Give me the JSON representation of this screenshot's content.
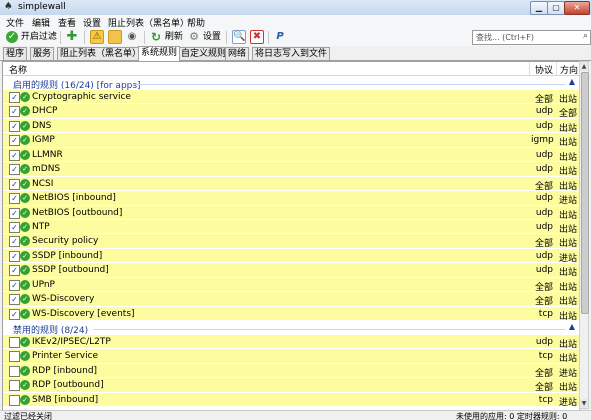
{
  "window": {
    "title": "simplewall"
  },
  "menu": [
    "文件",
    "编辑",
    "查看",
    "设置",
    "阻止列表（黑名单）",
    "帮助"
  ],
  "toolbar": {
    "enable_filter": "开启过滤",
    "refresh": "刷新",
    "settings": "设置"
  },
  "search": {
    "placeholder": "查找... (Ctrl+F)"
  },
  "tabs": [
    "程序",
    "服务",
    "阻止列表（黑名单）",
    "系统规则",
    "自定义规则",
    "网络",
    "将日志写入到文件"
  ],
  "active_tab": "系统规则",
  "columns": {
    "name": "名称",
    "protocol": "协议",
    "direction": "方向"
  },
  "groups": [
    {
      "label": "启用的规则 (16/24) [for apps]",
      "rows": [
        {
          "name": "Cryptographic service",
          "protocol": "全部",
          "direction": "出站",
          "checked": true
        },
        {
          "name": "DHCP",
          "protocol": "udp",
          "direction": "全部",
          "checked": true
        },
        {
          "name": "DNS",
          "protocol": "udp",
          "direction": "出站",
          "checked": true
        },
        {
          "name": "IGMP",
          "protocol": "igmp",
          "direction": "出站",
          "checked": true
        },
        {
          "name": "LLMNR",
          "protocol": "udp",
          "direction": "出站",
          "checked": true
        },
        {
          "name": "mDNS",
          "protocol": "udp",
          "direction": "出站",
          "checked": true
        },
        {
          "name": "NCSI",
          "protocol": "全部",
          "direction": "出站",
          "checked": true
        },
        {
          "name": "NetBIOS [inbound]",
          "protocol": "udp",
          "direction": "进站",
          "checked": true
        },
        {
          "name": "NetBIOS [outbound]",
          "protocol": "udp",
          "direction": "出站",
          "checked": true
        },
        {
          "name": "NTP",
          "protocol": "udp",
          "direction": "出站",
          "checked": true
        },
        {
          "name": "Security policy",
          "protocol": "全部",
          "direction": "出站",
          "checked": true
        },
        {
          "name": "SSDP [inbound]",
          "protocol": "udp",
          "direction": "进站",
          "checked": true
        },
        {
          "name": "SSDP [outbound]",
          "protocol": "udp",
          "direction": "出站",
          "checked": true
        },
        {
          "name": "UPnP",
          "protocol": "全部",
          "direction": "出站",
          "checked": true
        },
        {
          "name": "WS-Discovery",
          "protocol": "全部",
          "direction": "出站",
          "checked": true
        },
        {
          "name": "WS-Discovery [events]",
          "protocol": "tcp",
          "direction": "出站",
          "checked": true
        }
      ]
    },
    {
      "label": "禁用的规则 (8/24)",
      "rows": [
        {
          "name": "IKEv2/IPSEC/L2TP",
          "protocol": "udp",
          "direction": "出站",
          "checked": false
        },
        {
          "name": "Printer Service",
          "protocol": "tcp",
          "direction": "出站",
          "checked": false
        },
        {
          "name": "RDP [inbound]",
          "protocol": "全部",
          "direction": "进站",
          "checked": false
        },
        {
          "name": "RDP [outbound]",
          "protocol": "全部",
          "direction": "出站",
          "checked": false
        },
        {
          "name": "SMB [inbound]",
          "protocol": "tcp",
          "direction": "进站",
          "checked": false
        }
      ]
    }
  ],
  "status": {
    "left": "过滤已经关闭",
    "right": "未使用的应用: 0    定时器规则: 0"
  },
  "colors": {
    "row_bg": "#fdfd9f",
    "group_label": "#1e3f9a",
    "ok_icon": "#32a332"
  }
}
